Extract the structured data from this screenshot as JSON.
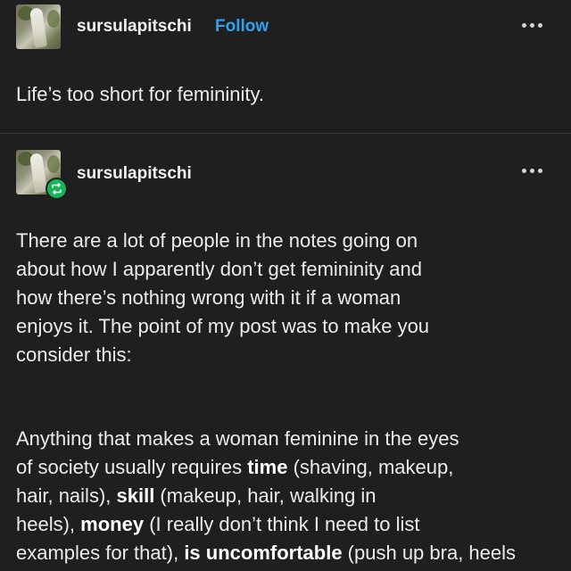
{
  "original_post": {
    "username": "sursulapitschi",
    "follow_label": "Follow",
    "text": "Life’s too short for femininity.",
    "more_icon": "more-dots-icon"
  },
  "reblog": {
    "username": "sursulapitschi",
    "badge_icon": "reblog-icon",
    "badge_color": "#17b557",
    "more_icon": "more-dots-icon",
    "paragraph1_lines": [
      "There are a lot of people in the notes going on",
      "about how I apparently don’t get femininity and",
      "how there’s nothing wrong with it if a woman",
      "enjoys it. The point of my post was to make you",
      "consider this:"
    ],
    "p2": {
      "l1": "Anything that makes a woman feminine in the eyes",
      "l2_pre": "of society usually requires ",
      "l2_bold": "time",
      "l2_post": " (shaving, makeup,",
      "l3_pre": "hair, nails), ",
      "l3_bold": "skill",
      "l3_post": " (makeup, hair, walking in",
      "l4_pre": "heels), ",
      "l4_bold": "money",
      "l4_post": " (I really don’t think I need to list",
      "l5_pre": "examples for that), ",
      "l5_bold": "is uncomfortable",
      "l5_post": " (push up bra, heels"
    }
  },
  "colors": {
    "background": "#1f1f1f",
    "text": "#ececec",
    "follow": "#2ea1ef",
    "divider": "#3b3b3b"
  }
}
